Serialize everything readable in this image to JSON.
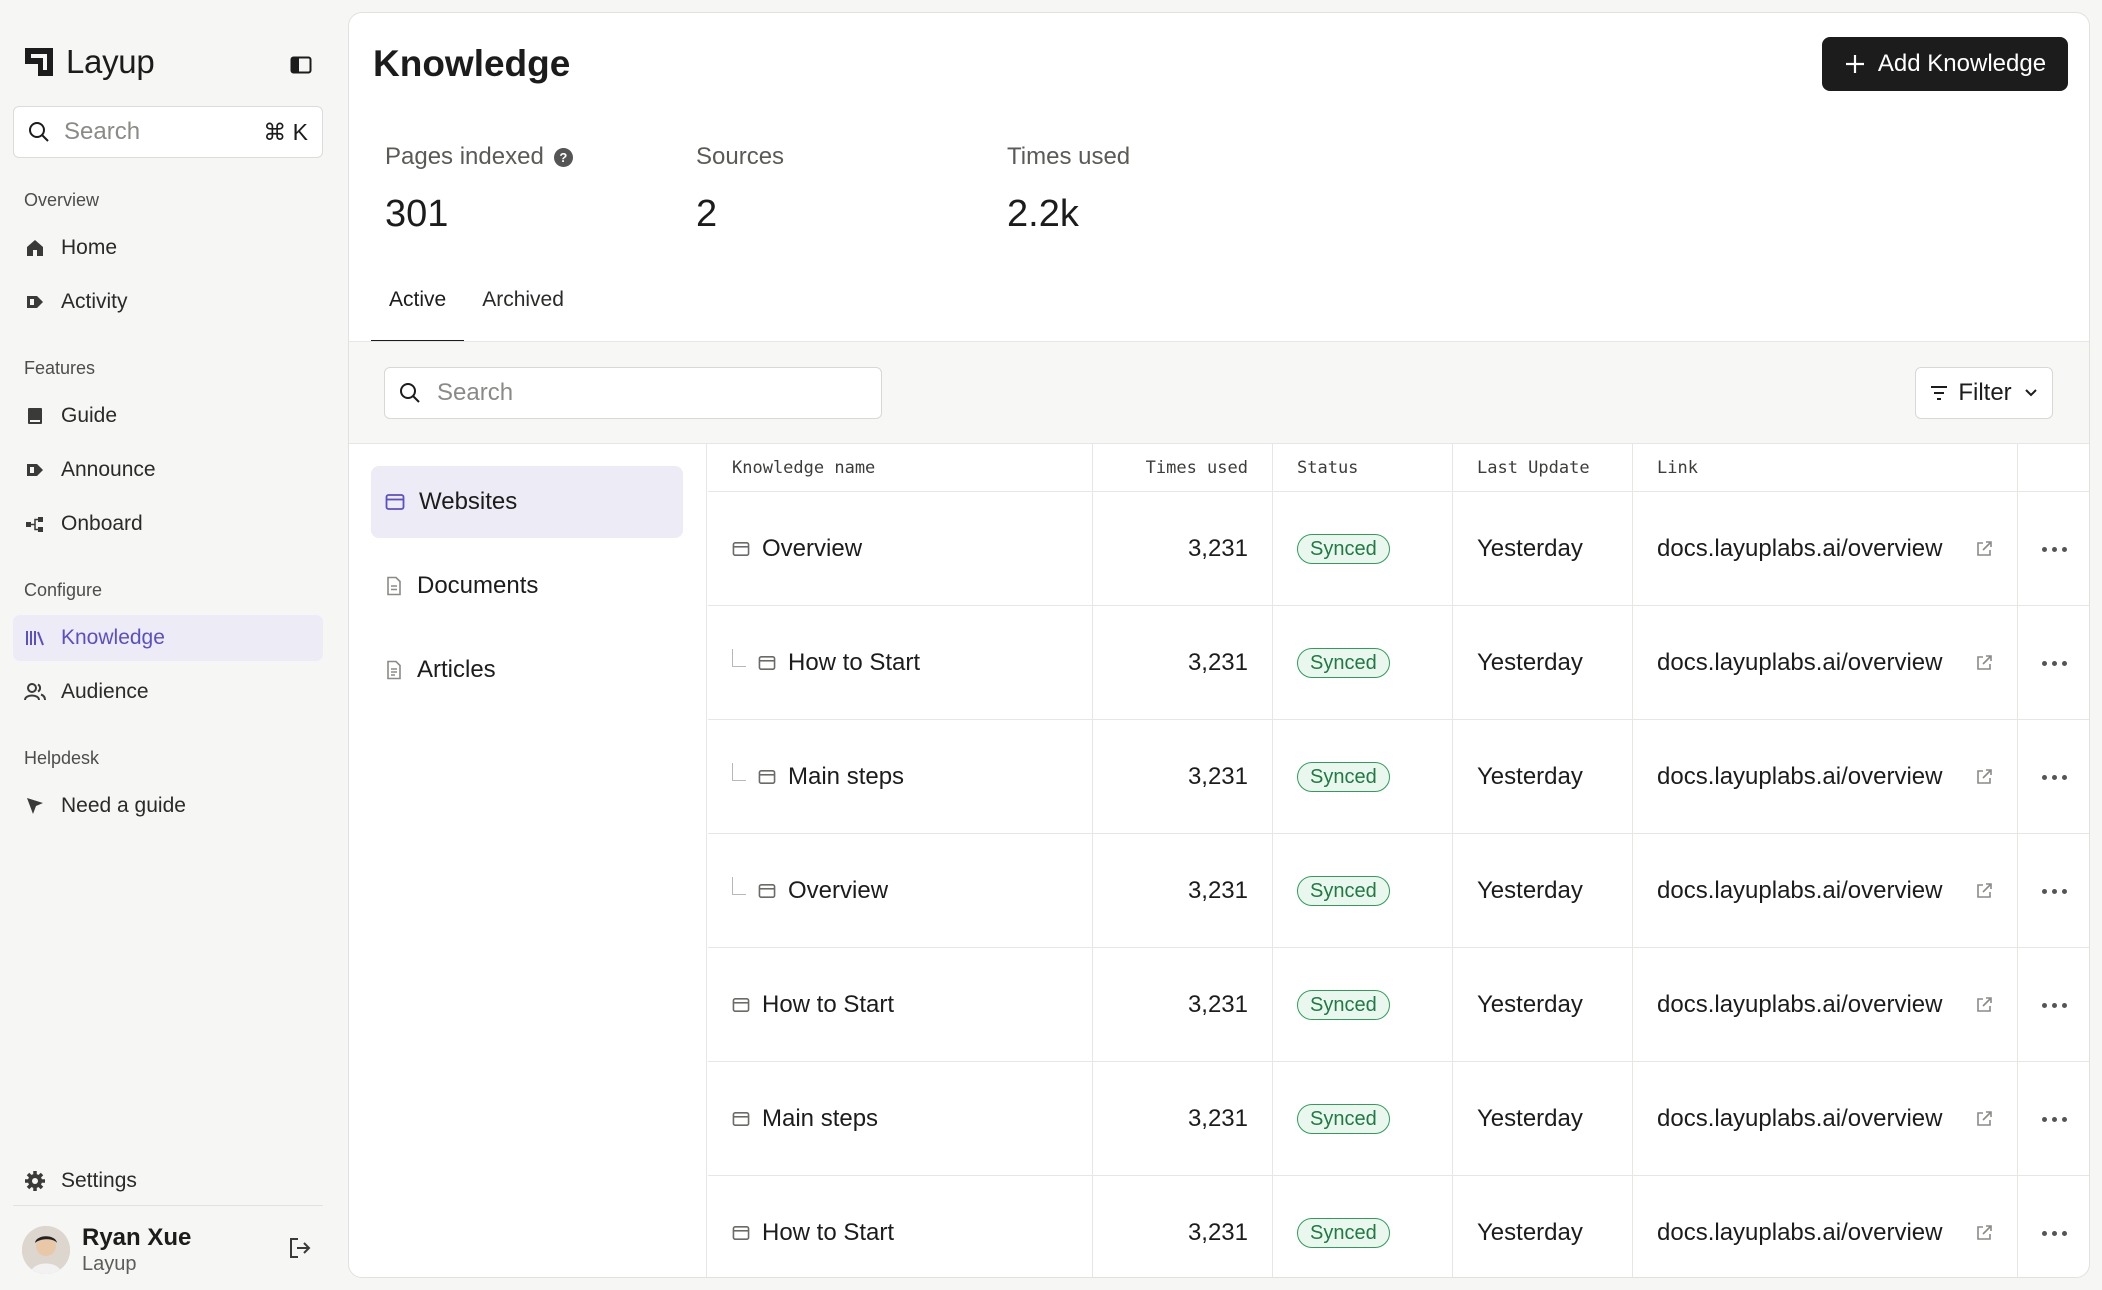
{
  "brand": {
    "name": "Layup"
  },
  "sidebar": {
    "search_placeholder": "Search",
    "search_shortcut": "⌘ K",
    "sections": {
      "overview": "Overview",
      "features": "Features",
      "configure": "Configure",
      "helpdesk": "Helpdesk"
    },
    "items": [
      {
        "label": "Home",
        "icon": "home-icon"
      },
      {
        "label": "Activity",
        "icon": "activity-icon"
      },
      {
        "label": "Guide",
        "icon": "book-icon"
      },
      {
        "label": "Announce",
        "icon": "announce-icon"
      },
      {
        "label": "Onboard",
        "icon": "flow-icon"
      },
      {
        "label": "Knowledge",
        "icon": "library-icon",
        "active": true
      },
      {
        "label": "Audience",
        "icon": "users-icon"
      },
      {
        "label": "Need a guide",
        "icon": "pointer-icon"
      }
    ],
    "settings_label": "Settings",
    "user": {
      "name": "Ryan Xue",
      "org": "Layup"
    }
  },
  "header": {
    "title": "Knowledge",
    "add_button": "Add Knowledge"
  },
  "stats": [
    {
      "label": "Pages indexed",
      "value": "301",
      "help": "?"
    },
    {
      "label": "Sources",
      "value": "2"
    },
    {
      "label": "Times used",
      "value": "2.2k"
    }
  ],
  "tabs": [
    {
      "label": "Active",
      "active": true
    },
    {
      "label": "Archived"
    }
  ],
  "toolbar": {
    "search_placeholder": "Search",
    "filter_label": "Filter"
  },
  "categories": [
    {
      "label": "Websites",
      "active": true
    },
    {
      "label": "Documents"
    },
    {
      "label": "Articles"
    }
  ],
  "table": {
    "columns": [
      "Knowledge name",
      "Times used",
      "Status",
      "Last Update",
      "Link",
      ""
    ],
    "rows": [
      {
        "name": "Overview",
        "child": false,
        "times": "3,231",
        "status": "Synced",
        "updated": "Yesterday",
        "link": "docs.layuplabs.ai/overview"
      },
      {
        "name": "How to Start",
        "child": true,
        "times": "3,231",
        "status": "Synced",
        "updated": "Yesterday",
        "link": "docs.layuplabs.ai/overview"
      },
      {
        "name": "Main steps",
        "child": true,
        "times": "3,231",
        "status": "Synced",
        "updated": "Yesterday",
        "link": "docs.layuplabs.ai/overview"
      },
      {
        "name": "Overview",
        "child": true,
        "times": "3,231",
        "status": "Synced",
        "updated": "Yesterday",
        "link": "docs.layuplabs.ai/overview"
      },
      {
        "name": "How to Start",
        "child": false,
        "times": "3,231",
        "status": "Synced",
        "updated": "Yesterday",
        "link": "docs.layuplabs.ai/overview"
      },
      {
        "name": "Main steps",
        "child": false,
        "times": "3,231",
        "status": "Synced",
        "updated": "Yesterday",
        "link": "docs.layuplabs.ai/overview"
      },
      {
        "name": "How to Start",
        "child": false,
        "times": "3,231",
        "status": "Synced",
        "updated": "Yesterday",
        "link": "docs.layuplabs.ai/overview"
      }
    ]
  },
  "colors": {
    "accent": "#5b4fc6",
    "active_bg": "#ecebf6",
    "synced_green": "#2f9e5a",
    "primary_button": "#1c1c1c"
  }
}
